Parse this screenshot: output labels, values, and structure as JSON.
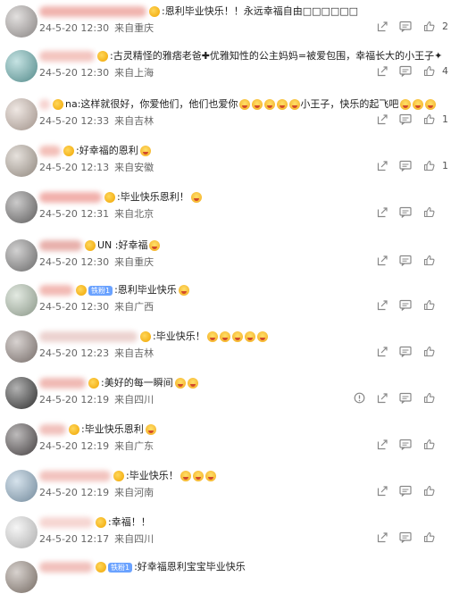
{
  "comments": [
    {
      "id": "c1",
      "text": ":恩利毕业快乐！！永远幸福自由□□□□□□",
      "time": "24-5-20 12:30",
      "location": "来自重庆",
      "likes": "2",
      "emoji": 0,
      "badge": "",
      "av": "#b6b0ae",
      "nameBlur": "#f0b3ae"
    },
    {
      "id": "c2",
      "text": ":古灵精怪的雅痞老爸✚优雅知性的公主妈妈=被爱包围，幸福长大的小王子✦",
      "time": "24-5-20 12:30",
      "location": "来自上海",
      "likes": "4",
      "emoji": 0,
      "badge": "",
      "av": "#6fb8b8",
      "nameBlur": "#f3c4bf"
    },
    {
      "id": "c3",
      "text": "na:这样就很好，你爱他们，他们也爱你",
      "text2": "小王子，快乐的起飞吧",
      "time": "24-5-20 12:33",
      "location": "来自吉林",
      "likes": "1",
      "emoji": 5,
      "emoji2": 3,
      "badge": "",
      "av": "#d6c3b8",
      "nameBlur": "#f6d2cf"
    },
    {
      "id": "c4",
      "text": ":好幸福的恩利",
      "time": "24-5-20 12:13",
      "location": "来自安徽",
      "likes": "1",
      "emoji": 1,
      "badge": "",
      "av": "#c0b4a8",
      "nameBlur": "#f3bfb8"
    },
    {
      "id": "c5",
      "text": ":毕业快乐恩利！",
      "time": "24-5-20 12:31",
      "location": "来自北京",
      "likes": "",
      "emoji": 1,
      "badge": "",
      "av": "#7d7b7b",
      "nameBlur": "#f1b0ab"
    },
    {
      "id": "c6",
      "text": "UN :好幸福",
      "time": "24-5-20 12:30",
      "location": "来自重庆",
      "likes": "",
      "emoji": 1,
      "badge": "",
      "av": "#8d8c8c",
      "nameBlur": "#e8b0ab"
    },
    {
      "id": "c7",
      "text": ":恩利毕业快乐",
      "time": "24-5-20 12:30",
      "location": "来自广西",
      "likes": "",
      "emoji": 1,
      "badge": "铁粉1",
      "av": "#b8c9b5",
      "nameBlur": "#f2b9b3"
    },
    {
      "id": "c8",
      "text": ":毕业快乐！",
      "time": "24-5-20 12:23",
      "location": "来自吉林",
      "likes": "",
      "emoji": 5,
      "badge": "",
      "av": "#9c8f8a",
      "nameBlur": "#ecd2cf"
    },
    {
      "id": "c9",
      "text": ":美好的每一瞬间",
      "time": "24-5-20 12:19",
      "location": "来自四川",
      "likes": "",
      "emoji": 2,
      "badge": "",
      "av": "#3e3e3e",
      "nameBlur": "#f0b9b3",
      "warn": true
    },
    {
      "id": "c10",
      "text": ":毕业快乐恩利",
      "time": "24-5-20 12:19",
      "location": "来自广东",
      "likes": "",
      "emoji": 1,
      "badge": "",
      "av": "#5a5455",
      "nameBlur": "#f1c1bc"
    },
    {
      "id": "c11",
      "text": ":毕业快乐！",
      "time": "24-5-20 12:19",
      "location": "来自河南",
      "likes": "",
      "emoji": 3,
      "badge": "",
      "av": "#98b7cf",
      "nameBlur": "#f2c3be"
    },
    {
      "id": "c12",
      "text": ":幸福！！",
      "time": "24-5-20 12:17",
      "location": "来自四川",
      "likes": "",
      "emoji": 0,
      "badge": "",
      "av": "#e7e7e7",
      "nameBlur": "#f6d6d2"
    },
    {
      "id": "c13",
      "text": ":好幸福恩利宝宝毕业快乐",
      "time": "",
      "location": "",
      "likes": "",
      "emoji": 0,
      "badge": "铁粉1",
      "av": "#9c8e84",
      "nameBlur": "#f1c1bc"
    }
  ],
  "icons": {
    "share": "share-icon",
    "comment": "comment-icon",
    "like": "thumbs-up-icon",
    "report": "warning-icon"
  }
}
